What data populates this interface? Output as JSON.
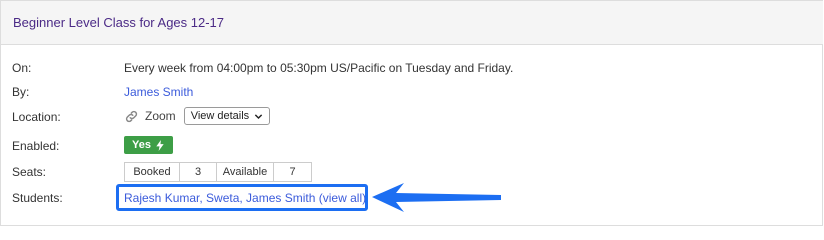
{
  "header": {
    "title": "Beginner Level Class for Ages 12-17"
  },
  "rows": {
    "on": {
      "label": "On:",
      "value": "Every week from 04:00pm to 05:30pm US/Pacific on Tuesday and Friday."
    },
    "by": {
      "label": "By:",
      "value": "James Smith"
    },
    "location": {
      "label": "Location:",
      "value": "Zoom",
      "details_button": "View details"
    },
    "enabled": {
      "label": "Enabled:",
      "badge": "Yes"
    },
    "seats": {
      "label": "Seats:",
      "booked_label": "Booked",
      "booked": "3",
      "available_label": "Available",
      "available": "7"
    },
    "students": {
      "label": "Students:",
      "names": "Rajesh Kumar, Sweta, James Smith",
      "view_all": "(view all)"
    }
  },
  "colors": {
    "title": "#4b2a86",
    "link": "#3b5bdb",
    "badge": "#3d9e46",
    "highlight": "#1c6ef2"
  },
  "icons": {
    "location": "link-icon",
    "dropdown": "chevron-down-icon",
    "enabled": "lightning-bolt-icon",
    "callout": "arrow-left-icon"
  }
}
